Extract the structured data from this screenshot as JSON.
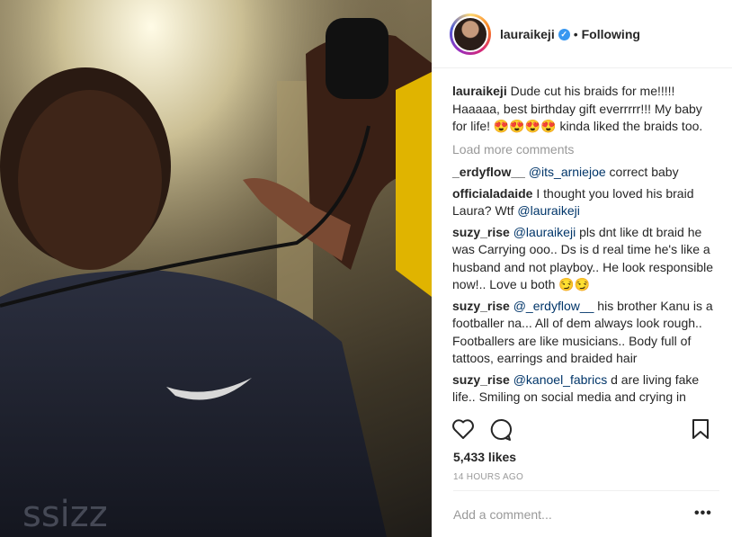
{
  "header": {
    "username": "lauraikeji",
    "separator": "•",
    "follow_label": "Following",
    "verified_icon": "verified-check-icon"
  },
  "caption": {
    "username": "lauraikeji",
    "text": "Dude cut his braids for me!!!!! Haaaaa, best birthday gift everrrrr!!! My baby for life! 😍😍😍😍 kinda liked the braids too."
  },
  "load_more_label": "Load more comments",
  "comments": [
    {
      "username": "_erdyflow__",
      "mention": "@its_arniejoe",
      "text": " correct baby"
    },
    {
      "username": "officialadaide",
      "text_before": "I thought you loved his braid Laura? Wtf ",
      "mention": "@lauraikeji"
    },
    {
      "username": "suzy_rise",
      "mention": "@lauraikeji",
      "text": " pls dnt like dt braid he was Carrying ooo.. Ds is d real time he's like a husband and not playboy.. He look responsible now!.. Love u both 😏😏"
    },
    {
      "username": "suzy_rise",
      "mention": "@_erdyflow__",
      "text": " his brother Kanu is a footballer na... All of dem always look rough.. Footballers are like musicians.. Body full of tattoos, earrings and braided hair"
    },
    {
      "username": "suzy_rise",
      "mention": "@kanoel_fabrics",
      "text": " d are living fake life.. Smiling on social media and crying in"
    }
  ],
  "actions": {
    "like_icon": "heart-icon",
    "comment_icon": "comment-bubble-icon",
    "save_icon": "bookmark-icon"
  },
  "likes_text": "5,433 likes",
  "timestamp": "14 HOURS AGO",
  "add_comment_placeholder": "Add a comment...",
  "options_label": "•••",
  "media": {
    "shirt_text": "ssizz"
  }
}
